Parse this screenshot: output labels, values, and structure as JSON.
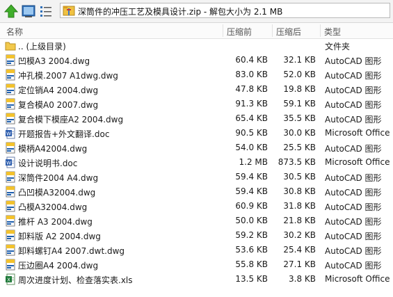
{
  "path": "深筒件的冲压工艺及模具设计.zip - 解包大小为 2.1 MB",
  "columns": {
    "name": "名称",
    "size": "压缩前",
    "packed": "压缩后",
    "type": "类型"
  },
  "parent": {
    "name": ".. (上级目录)",
    "type": "文件夹"
  },
  "files": [
    {
      "name": "凹模A3  2004.dwg",
      "size": "60.4 KB",
      "packed": "32.1 KB",
      "type": "AutoCAD 图形",
      "icon": "dwg"
    },
    {
      "name": "冲孔模.2007 A1dwg.dwg",
      "size": "83.0 KB",
      "packed": "52.0 KB",
      "type": "AutoCAD 图形",
      "icon": "dwg"
    },
    {
      "name": "定位销A4  2004.dwg",
      "size": "47.8 KB",
      "packed": "19.8 KB",
      "type": "AutoCAD 图形",
      "icon": "dwg"
    },
    {
      "name": "复合模A0 2007.dwg",
      "size": "91.3 KB",
      "packed": "59.1 KB",
      "type": "AutoCAD 图形",
      "icon": "dwg"
    },
    {
      "name": "复合模下模座A2 2004.dwg",
      "size": "65.4 KB",
      "packed": "35.5 KB",
      "type": "AutoCAD 图形",
      "icon": "dwg"
    },
    {
      "name": "开题报告+外文翻译.doc",
      "size": "90.5 KB",
      "packed": "30.0 KB",
      "type": "Microsoft Office",
      "icon": "doc"
    },
    {
      "name": "模柄A42004.dwg",
      "size": "54.0 KB",
      "packed": "25.5 KB",
      "type": "AutoCAD 图形",
      "icon": "dwg"
    },
    {
      "name": "设计说明书.doc",
      "size": "1.2 MB",
      "packed": "873.5 KB",
      "type": "Microsoft Office",
      "icon": "doc"
    },
    {
      "name": "深筒件2004 A4.dwg",
      "size": "59.4 KB",
      "packed": "30.5 KB",
      "type": "AutoCAD 图形",
      "icon": "dwg"
    },
    {
      "name": "凸凹模A32004.dwg",
      "size": "59.4 KB",
      "packed": "30.8 KB",
      "type": "AutoCAD 图形",
      "icon": "dwg"
    },
    {
      "name": "凸模A32004.dwg",
      "size": "60.9 KB",
      "packed": "31.8 KB",
      "type": "AutoCAD 图形",
      "icon": "dwg"
    },
    {
      "name": "推杆 A3 2004.dwg",
      "size": "50.0 KB",
      "packed": "21.8 KB",
      "type": "AutoCAD 图形",
      "icon": "dwg"
    },
    {
      "name": "卸料版  A2 2004.dwg",
      "size": "59.2 KB",
      "packed": "30.2 KB",
      "type": "AutoCAD 图形",
      "icon": "dwg"
    },
    {
      "name": "卸料螺钉A4  2007.dwt.dwg",
      "size": "53.6 KB",
      "packed": "25.4 KB",
      "type": "AutoCAD 图形",
      "icon": "dwg"
    },
    {
      "name": "压边圈A4 2004.dwg",
      "size": "55.8 KB",
      "packed": "27.1 KB",
      "type": "AutoCAD 图形",
      "icon": "dwg"
    },
    {
      "name": "周次进度计划、检查落实表.xls",
      "size": "13.5 KB",
      "packed": "3.8 KB",
      "type": "Microsoft Office",
      "icon": "xls"
    }
  ]
}
